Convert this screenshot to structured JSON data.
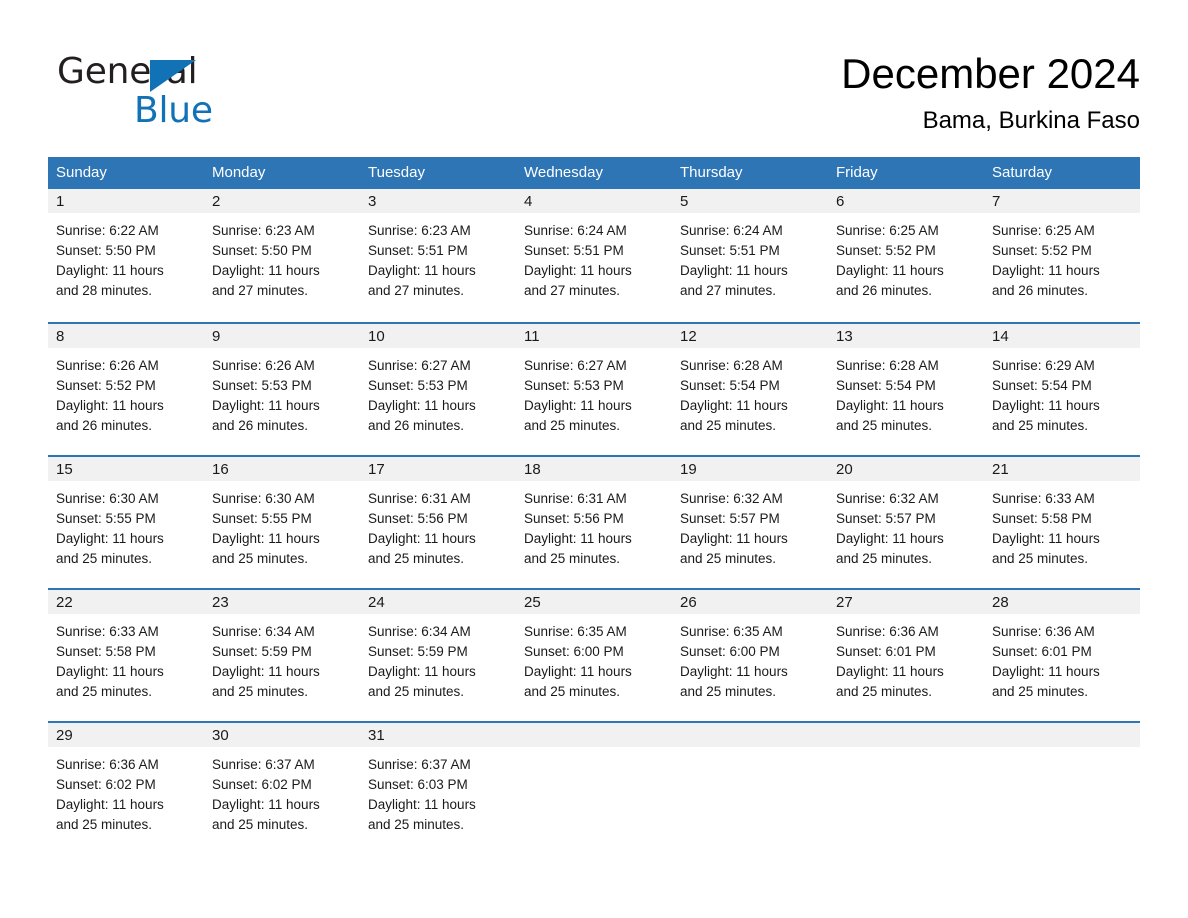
{
  "brand": {
    "name_part1": "General",
    "name_part2": "Blue",
    "accent_color": "#1272b6",
    "logo_icon": "triangle-logo-icon"
  },
  "header": {
    "month_title": "December 2024",
    "location": "Bama, Burkina Faso"
  },
  "calendar": {
    "header_bg": "#2e75b6",
    "day_band_bg": "#f1f1f1",
    "weekdays": [
      "Sunday",
      "Monday",
      "Tuesday",
      "Wednesday",
      "Thursday",
      "Friday",
      "Saturday"
    ],
    "weeks": [
      [
        {
          "day": "1",
          "sunrise": "Sunrise: 6:22 AM",
          "sunset": "Sunset: 5:50 PM",
          "daylight_line1": "Daylight: 11 hours",
          "daylight_line2": "and 28 minutes."
        },
        {
          "day": "2",
          "sunrise": "Sunrise: 6:23 AM",
          "sunset": "Sunset: 5:50 PM",
          "daylight_line1": "Daylight: 11 hours",
          "daylight_line2": "and 27 minutes."
        },
        {
          "day": "3",
          "sunrise": "Sunrise: 6:23 AM",
          "sunset": "Sunset: 5:51 PM",
          "daylight_line1": "Daylight: 11 hours",
          "daylight_line2": "and 27 minutes."
        },
        {
          "day": "4",
          "sunrise": "Sunrise: 6:24 AM",
          "sunset": "Sunset: 5:51 PM",
          "daylight_line1": "Daylight: 11 hours",
          "daylight_line2": "and 27 minutes."
        },
        {
          "day": "5",
          "sunrise": "Sunrise: 6:24 AM",
          "sunset": "Sunset: 5:51 PM",
          "daylight_line1": "Daylight: 11 hours",
          "daylight_line2": "and 27 minutes."
        },
        {
          "day": "6",
          "sunrise": "Sunrise: 6:25 AM",
          "sunset": "Sunset: 5:52 PM",
          "daylight_line1": "Daylight: 11 hours",
          "daylight_line2": "and 26 minutes."
        },
        {
          "day": "7",
          "sunrise": "Sunrise: 6:25 AM",
          "sunset": "Sunset: 5:52 PM",
          "daylight_line1": "Daylight: 11 hours",
          "daylight_line2": "and 26 minutes."
        }
      ],
      [
        {
          "day": "8",
          "sunrise": "Sunrise: 6:26 AM",
          "sunset": "Sunset: 5:52 PM",
          "daylight_line1": "Daylight: 11 hours",
          "daylight_line2": "and 26 minutes."
        },
        {
          "day": "9",
          "sunrise": "Sunrise: 6:26 AM",
          "sunset": "Sunset: 5:53 PM",
          "daylight_line1": "Daylight: 11 hours",
          "daylight_line2": "and 26 minutes."
        },
        {
          "day": "10",
          "sunrise": "Sunrise: 6:27 AM",
          "sunset": "Sunset: 5:53 PM",
          "daylight_line1": "Daylight: 11 hours",
          "daylight_line2": "and 26 minutes."
        },
        {
          "day": "11",
          "sunrise": "Sunrise: 6:27 AM",
          "sunset": "Sunset: 5:53 PM",
          "daylight_line1": "Daylight: 11 hours",
          "daylight_line2": "and 25 minutes."
        },
        {
          "day": "12",
          "sunrise": "Sunrise: 6:28 AM",
          "sunset": "Sunset: 5:54 PM",
          "daylight_line1": "Daylight: 11 hours",
          "daylight_line2": "and 25 minutes."
        },
        {
          "day": "13",
          "sunrise": "Sunrise: 6:28 AM",
          "sunset": "Sunset: 5:54 PM",
          "daylight_line1": "Daylight: 11 hours",
          "daylight_line2": "and 25 minutes."
        },
        {
          "day": "14",
          "sunrise": "Sunrise: 6:29 AM",
          "sunset": "Sunset: 5:54 PM",
          "daylight_line1": "Daylight: 11 hours",
          "daylight_line2": "and 25 minutes."
        }
      ],
      [
        {
          "day": "15",
          "sunrise": "Sunrise: 6:30 AM",
          "sunset": "Sunset: 5:55 PM",
          "daylight_line1": "Daylight: 11 hours",
          "daylight_line2": "and 25 minutes."
        },
        {
          "day": "16",
          "sunrise": "Sunrise: 6:30 AM",
          "sunset": "Sunset: 5:55 PM",
          "daylight_line1": "Daylight: 11 hours",
          "daylight_line2": "and 25 minutes."
        },
        {
          "day": "17",
          "sunrise": "Sunrise: 6:31 AM",
          "sunset": "Sunset: 5:56 PM",
          "daylight_line1": "Daylight: 11 hours",
          "daylight_line2": "and 25 minutes."
        },
        {
          "day": "18",
          "sunrise": "Sunrise: 6:31 AM",
          "sunset": "Sunset: 5:56 PM",
          "daylight_line1": "Daylight: 11 hours",
          "daylight_line2": "and 25 minutes."
        },
        {
          "day": "19",
          "sunrise": "Sunrise: 6:32 AM",
          "sunset": "Sunset: 5:57 PM",
          "daylight_line1": "Daylight: 11 hours",
          "daylight_line2": "and 25 minutes."
        },
        {
          "day": "20",
          "sunrise": "Sunrise: 6:32 AM",
          "sunset": "Sunset: 5:57 PM",
          "daylight_line1": "Daylight: 11 hours",
          "daylight_line2": "and 25 minutes."
        },
        {
          "day": "21",
          "sunrise": "Sunrise: 6:33 AM",
          "sunset": "Sunset: 5:58 PM",
          "daylight_line1": "Daylight: 11 hours",
          "daylight_line2": "and 25 minutes."
        }
      ],
      [
        {
          "day": "22",
          "sunrise": "Sunrise: 6:33 AM",
          "sunset": "Sunset: 5:58 PM",
          "daylight_line1": "Daylight: 11 hours",
          "daylight_line2": "and 25 minutes."
        },
        {
          "day": "23",
          "sunrise": "Sunrise: 6:34 AM",
          "sunset": "Sunset: 5:59 PM",
          "daylight_line1": "Daylight: 11 hours",
          "daylight_line2": "and 25 minutes."
        },
        {
          "day": "24",
          "sunrise": "Sunrise: 6:34 AM",
          "sunset": "Sunset: 5:59 PM",
          "daylight_line1": "Daylight: 11 hours",
          "daylight_line2": "and 25 minutes."
        },
        {
          "day": "25",
          "sunrise": "Sunrise: 6:35 AM",
          "sunset": "Sunset: 6:00 PM",
          "daylight_line1": "Daylight: 11 hours",
          "daylight_line2": "and 25 minutes."
        },
        {
          "day": "26",
          "sunrise": "Sunrise: 6:35 AM",
          "sunset": "Sunset: 6:00 PM",
          "daylight_line1": "Daylight: 11 hours",
          "daylight_line2": "and 25 minutes."
        },
        {
          "day": "27",
          "sunrise": "Sunrise: 6:36 AM",
          "sunset": "Sunset: 6:01 PM",
          "daylight_line1": "Daylight: 11 hours",
          "daylight_line2": "and 25 minutes."
        },
        {
          "day": "28",
          "sunrise": "Sunrise: 6:36 AM",
          "sunset": "Sunset: 6:01 PM",
          "daylight_line1": "Daylight: 11 hours",
          "daylight_line2": "and 25 minutes."
        }
      ],
      [
        {
          "day": "29",
          "sunrise": "Sunrise: 6:36 AM",
          "sunset": "Sunset: 6:02 PM",
          "daylight_line1": "Daylight: 11 hours",
          "daylight_line2": "and 25 minutes."
        },
        {
          "day": "30",
          "sunrise": "Sunrise: 6:37 AM",
          "sunset": "Sunset: 6:02 PM",
          "daylight_line1": "Daylight: 11 hours",
          "daylight_line2": "and 25 minutes."
        },
        {
          "day": "31",
          "sunrise": "Sunrise: 6:37 AM",
          "sunset": "Sunset: 6:03 PM",
          "daylight_line1": "Daylight: 11 hours",
          "daylight_line2": "and 25 minutes."
        },
        {
          "day": "",
          "sunrise": "",
          "sunset": "",
          "daylight_line1": "",
          "daylight_line2": ""
        },
        {
          "day": "",
          "sunrise": "",
          "sunset": "",
          "daylight_line1": "",
          "daylight_line2": ""
        },
        {
          "day": "",
          "sunrise": "",
          "sunset": "",
          "daylight_line1": "",
          "daylight_line2": ""
        },
        {
          "day": "",
          "sunrise": "",
          "sunset": "",
          "daylight_line1": "",
          "daylight_line2": ""
        }
      ]
    ]
  }
}
